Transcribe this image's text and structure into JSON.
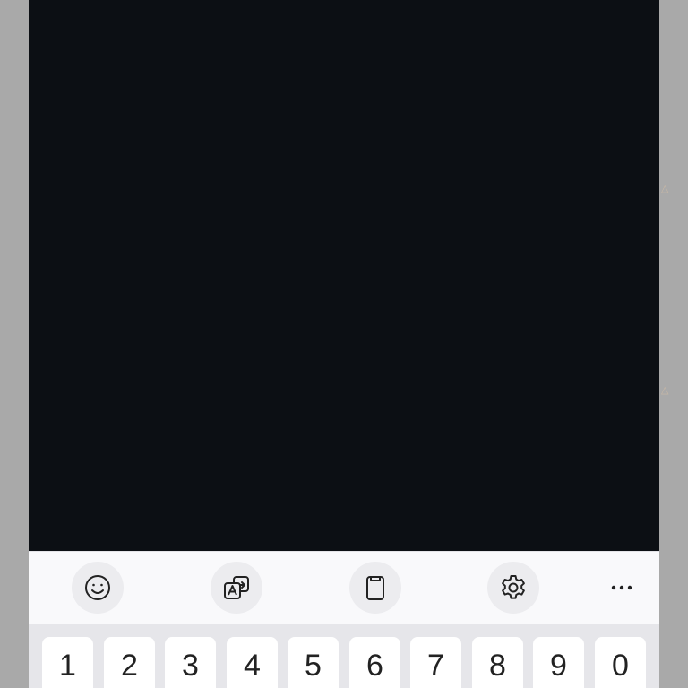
{
  "toolbar": {
    "buttons": [
      {
        "name": "emoji",
        "icon": "emoji-icon"
      },
      {
        "name": "translate",
        "icon": "translate-icon"
      },
      {
        "name": "clipboard",
        "icon": "clipboard-icon"
      },
      {
        "name": "settings",
        "icon": "gear-icon"
      },
      {
        "name": "more",
        "icon": "more-horizontal-icon"
      }
    ]
  },
  "number_row": {
    "keys": [
      "1",
      "2",
      "3",
      "4",
      "5",
      "6",
      "7",
      "8",
      "9",
      "0"
    ]
  },
  "colors": {
    "background_dark": "#0c0f14",
    "toolbar_bg": "#f9f9fb",
    "key_bg": "#ffffff",
    "frame": "#a9a9a9"
  }
}
